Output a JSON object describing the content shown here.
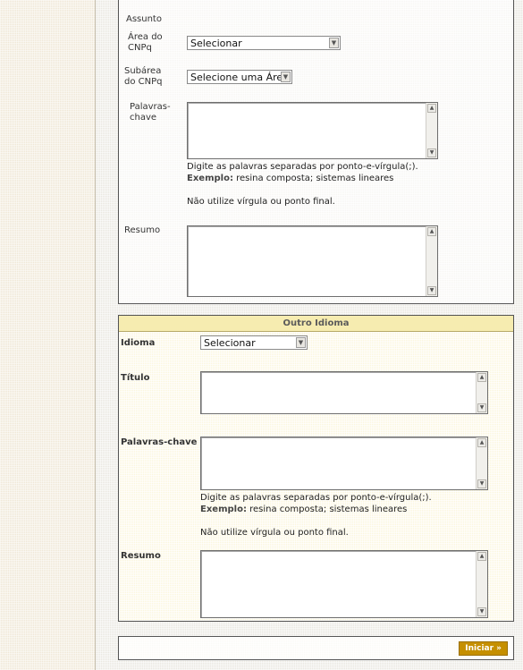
{
  "subject_section": {
    "heading": "Assunto",
    "area_label": "Área do CNPq",
    "area_value": "Selecionar",
    "subarea_label": "Subárea do CNPq",
    "subarea_value": "Selecione uma Área",
    "keywords_label": "Palavras-chave",
    "keywords_hint_line1": "Digite as palavras separadas por ponto-e-vírgula(;).",
    "keywords_hint_example_label": "Exemplo:",
    "keywords_hint_example_text": " resina composta; sistemas lineares",
    "keywords_hint_line3": "Não utilize vírgula ou ponto final.",
    "abstract_label": "Resumo"
  },
  "other_language_section": {
    "title": "Outro Idioma",
    "language_label": "Idioma",
    "language_value": "Selecionar",
    "title_label": "Título",
    "keywords_label": "Palavras-chave",
    "keywords_hint_line1": "Digite as palavras separadas por ponto-e-vírgula(;).",
    "keywords_hint_example_label": "Exemplo:",
    "keywords_hint_example_text": " resina composta; sistemas lineares",
    "keywords_hint_line3": "Não utilize vírgula ou ponto final.",
    "abstract_label": "Resumo"
  },
  "footer": {
    "start_button": "Iniciar »"
  },
  "icons": {
    "dropdown": "chevron-down-icon",
    "scroll_up": "scroll-up-arrow-icon",
    "scroll_down": "scroll-down-arrow-icon"
  },
  "colors": {
    "page_bg": "#e9e7e0",
    "left_column_bg": "#efe7d6",
    "other_language_bg": "#fbf6dc",
    "title_bar_bg": "#f6ecb0",
    "button_bg": "#c58f00"
  }
}
